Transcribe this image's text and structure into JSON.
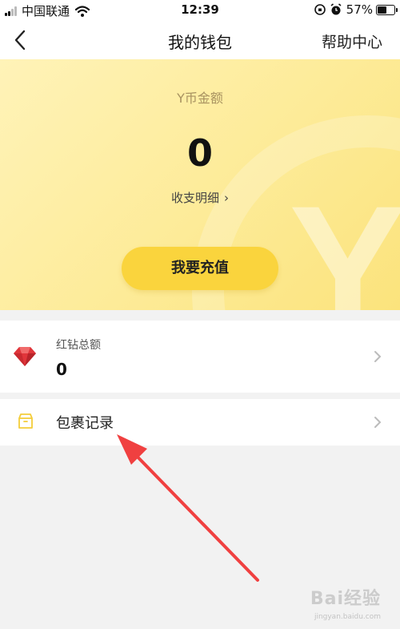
{
  "status_bar": {
    "carrier": "中国联通",
    "time": "12:39",
    "battery": "57%"
  },
  "nav": {
    "title": "我的钱包",
    "help_label": "帮助中心",
    "back_icon": "chevron-left-icon"
  },
  "wallet": {
    "balance_label": "Y币金额",
    "balance_value": "0",
    "details_label": "收支明细",
    "recharge_label": "我要充值"
  },
  "diamond": {
    "label": "红钻总额",
    "value": "0",
    "icon": "diamond-icon",
    "color": "#e0353a"
  },
  "package": {
    "label": "包裹记录",
    "icon": "box-icon",
    "color": "#f4cd3a"
  },
  "annotation": {
    "arrow_color": "#f04040"
  },
  "watermark": {
    "text": "Bai经验",
    "sub": "jingyan.baidu.com"
  },
  "colors": {
    "accent": "#fad43d",
    "hero": "#fdeb98",
    "background": "#f2f2f2"
  }
}
